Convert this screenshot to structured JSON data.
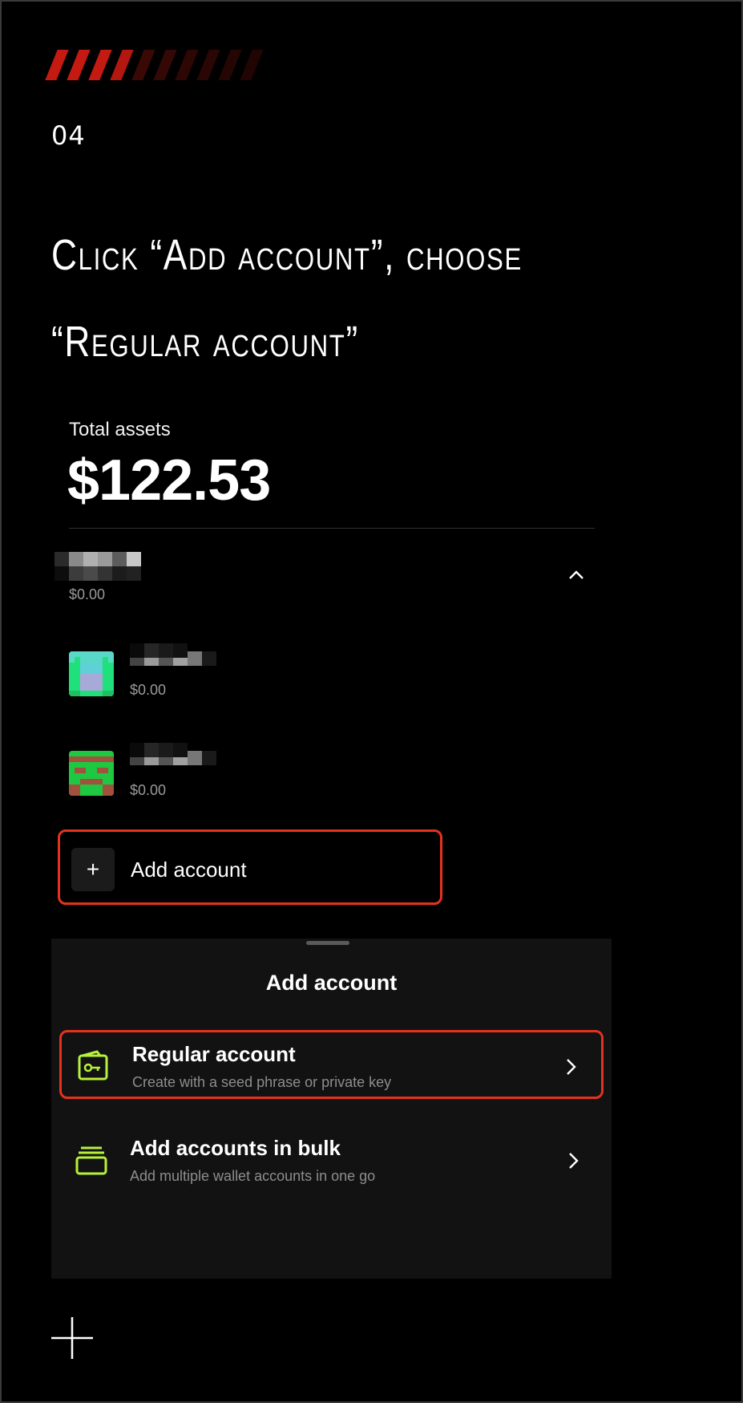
{
  "step": {
    "number": "04"
  },
  "headline": {
    "line1": "Click “Add account”, choose",
    "line2": "“Regular account”"
  },
  "wallet": {
    "total_label": "Total assets",
    "total_value": "$122.53",
    "group_balance": "$0.00",
    "accounts": [
      {
        "balance": "$0.00"
      },
      {
        "balance": "$0.00"
      }
    ],
    "add_account_label": "Add account"
  },
  "sheet": {
    "title": "Add account",
    "options": [
      {
        "title": "Regular account",
        "subtitle": "Create with a seed phrase or private key"
      },
      {
        "title": "Add accounts in bulk",
        "subtitle": "Add multiple wallet accounts in one go"
      }
    ]
  },
  "colors": {
    "highlight": "#e5321e",
    "icon_accent": "#b7f13a",
    "stripe_red": "#c41a12"
  },
  "icons": {
    "add": "plus-icon",
    "regular_account": "wallet-key-icon",
    "bulk": "stack-icon",
    "chevron_right": "chevron-right-icon",
    "chevron_up": "chevron-up-icon"
  }
}
